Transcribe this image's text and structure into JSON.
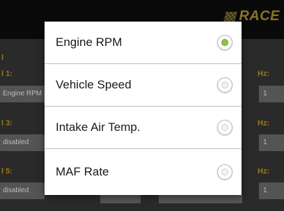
{
  "app": {
    "brand": "RACE",
    "brand_icon": "checkered-flag-icon"
  },
  "background": {
    "rows": [
      {
        "channel_label": "l 1:",
        "value": "Engine RPM",
        "hz_label": "Hz:",
        "hz_value": "1"
      },
      {
        "channel_label": "l 3:",
        "value": "disabled",
        "hz_label": "Hz:",
        "hz_value": "1"
      },
      {
        "channel_label": "l 5:",
        "value": "disabled",
        "hz_label": "Hz:",
        "hz_value": "1"
      }
    ]
  },
  "dialog": {
    "options": [
      {
        "label": "Engine RPM",
        "selected": true
      },
      {
        "label": "Vehicle Speed",
        "selected": false
      },
      {
        "label": "Intake Air Temp.",
        "selected": false
      },
      {
        "label": "MAF Rate",
        "selected": false
      }
    ]
  },
  "colors": {
    "accent_gold": "#9a7716",
    "radio_selected": "#8cc63f"
  }
}
